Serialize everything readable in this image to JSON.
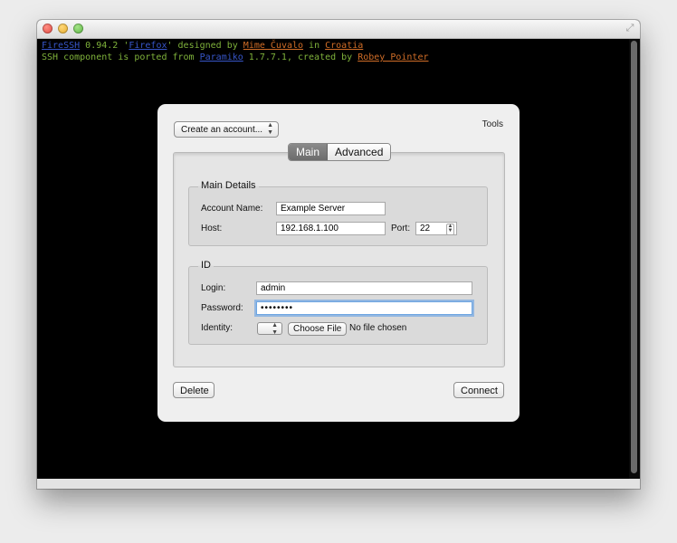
{
  "terminal": {
    "line1": {
      "app_link": "FireSSH",
      "version": " 0.94.2 '",
      "codename_link": "Firefox",
      "designed_by": "' designed by ",
      "designer_link": "Mime Čuvalo",
      "in_text": " in ",
      "country_link": "Croatia"
    },
    "line2": {
      "prefix": "SSH component is ported from ",
      "lib_link": "Paramiko",
      "lib_version": " 1.7.7.1, created by ",
      "author_link": "Robey Pointer"
    }
  },
  "dialog": {
    "account_select": "Create an account...",
    "tools_label": "Tools",
    "tabs": [
      {
        "label": "Main",
        "active": true
      },
      {
        "label": "Advanced",
        "active": false
      }
    ],
    "main_details": {
      "legend": "Main Details",
      "account_name_label": "Account Name:",
      "account_name_value": "Example Server",
      "host_label": "Host:",
      "host_value": "192.168.1.100",
      "port_label": "Port:",
      "port_value": "22"
    },
    "id_section": {
      "legend": "ID",
      "login_label": "Login:",
      "login_value": "admin",
      "password_label": "Password:",
      "password_value": "••••••••",
      "identity_label": "Identity:",
      "choose_file_label": "Choose File",
      "no_file_text": "No file chosen"
    },
    "delete_label": "Delete",
    "connect_label": "Connect"
  },
  "colors": {
    "terminal_bg": "#000000",
    "terminal_text": "#7fb23b",
    "link_blue": "#3756c9",
    "link_orange": "#d06d27",
    "focus_ring": "#6ea6e2"
  }
}
